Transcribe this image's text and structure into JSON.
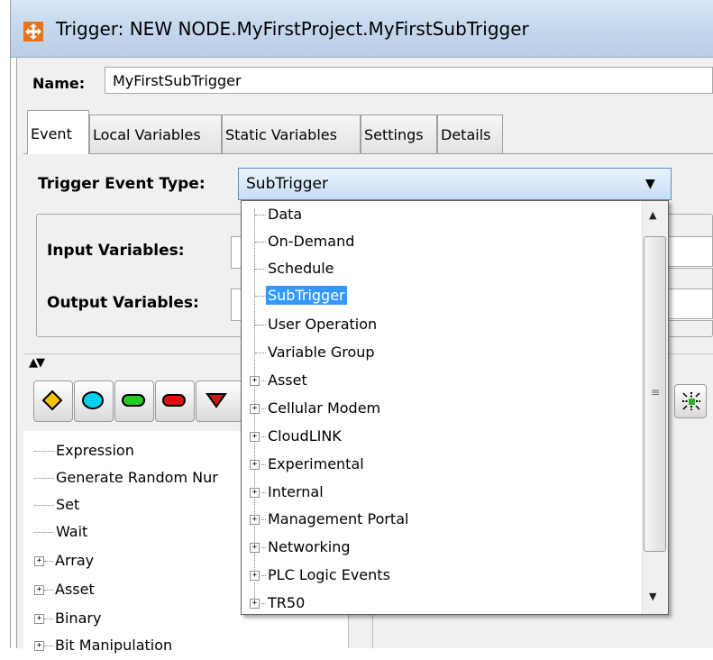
{
  "window": {
    "title": "Trigger:  NEW NODE.MyFirstProject.MyFirstSubTrigger"
  },
  "name_field": {
    "label": "Name:",
    "value": "MyFirstSubTrigger"
  },
  "tabs": [
    {
      "label": "Event",
      "active": true
    },
    {
      "label": "Local Variables",
      "active": false
    },
    {
      "label": "Static Variables",
      "active": false
    },
    {
      "label": "Settings",
      "active": false
    },
    {
      "label": "Details",
      "active": false
    }
  ],
  "event_type": {
    "label": "Trigger Event Type:",
    "selected": "SubTrigger",
    "options": [
      {
        "label": "Data",
        "expandable": false
      },
      {
        "label": "On-Demand",
        "expandable": false
      },
      {
        "label": "Schedule",
        "expandable": false
      },
      {
        "label": "SubTrigger",
        "expandable": false,
        "selected": true
      },
      {
        "label": "User Operation",
        "expandable": false
      },
      {
        "label": "Variable Group",
        "expandable": false
      },
      {
        "label": "Asset",
        "expandable": true
      },
      {
        "label": "Cellular Modem",
        "expandable": true
      },
      {
        "label": "CloudLINK",
        "expandable": true
      },
      {
        "label": "Experimental",
        "expandable": true
      },
      {
        "label": "Internal",
        "expandable": true
      },
      {
        "label": "Management Portal",
        "expandable": true
      },
      {
        "label": "Networking",
        "expandable": true
      },
      {
        "label": "PLC Logic Events",
        "expandable": true
      },
      {
        "label": "TR50",
        "expandable": true
      }
    ]
  },
  "variables": {
    "input_label": "Input Variables:",
    "output_label": "Output Variables:"
  },
  "toolbar": {
    "tools": [
      {
        "icon": "diamond-icon",
        "color": "#f5c400"
      },
      {
        "icon": "ellipse-icon",
        "color": "#00d0f0"
      },
      {
        "icon": "rounded-rect-icon",
        "color": "#22cc22"
      },
      {
        "icon": "rounded-rect-icon",
        "color": "#e01010"
      },
      {
        "icon": "triangle-icon",
        "color": "#e01010"
      }
    ],
    "right_icon": "network-node-icon"
  },
  "action_tree": {
    "items": [
      {
        "label": "Expression",
        "expandable": false
      },
      {
        "label": "Generate Random Nur",
        "expandable": false
      },
      {
        "label": "Set",
        "expandable": false
      },
      {
        "label": "Wait",
        "expandable": false
      },
      {
        "label": "Array",
        "expandable": true
      },
      {
        "label": "Asset",
        "expandable": true
      },
      {
        "label": "Binary",
        "expandable": true
      },
      {
        "label": "Bit Manipulation",
        "expandable": true
      }
    ]
  },
  "colors": {
    "titlebar": "#c3d6ec",
    "selection": "#3399ff",
    "select_border": "#5b8fc8"
  }
}
